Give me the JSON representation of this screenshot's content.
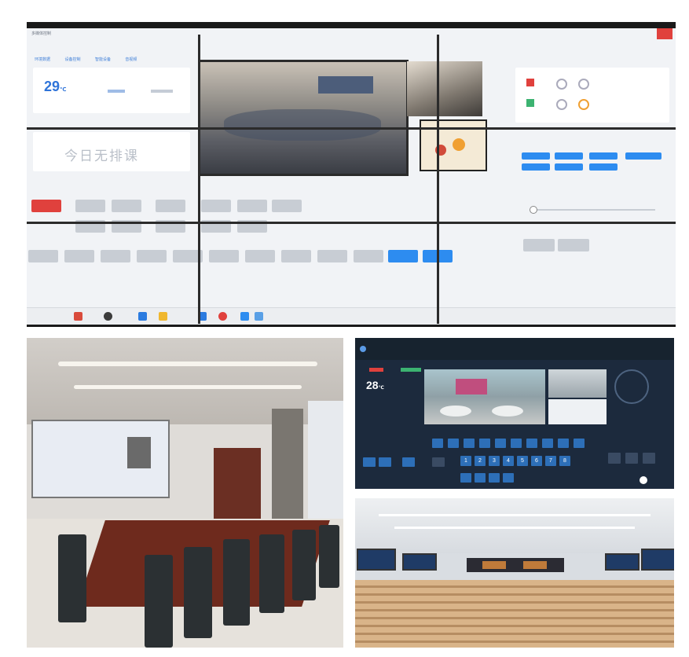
{
  "wall": {
    "title": "多媒体控制",
    "tabs": [
      "环境数据",
      "设备控制",
      "智能设备",
      "音视频"
    ],
    "temperature": {
      "value": "29",
      "unit": "℃"
    },
    "schedule_text": "今日无排课"
  },
  "control_ui": {
    "temperature": {
      "value": "28",
      "unit": "℃"
    },
    "number_keys": [
      "1",
      "2",
      "3",
      "4",
      "5",
      "6",
      "7",
      "8"
    ]
  },
  "colors": {
    "accent_blue": "#2d8cf0",
    "danger_red": "#e0413d",
    "wall_bg": "#f1f3f6",
    "control_bg": "#1c2a3d"
  },
  "icons": [
    "camera-icon",
    "monitor-icon",
    "power-icon",
    "windows-start-icon",
    "ptz-control-icon"
  ]
}
